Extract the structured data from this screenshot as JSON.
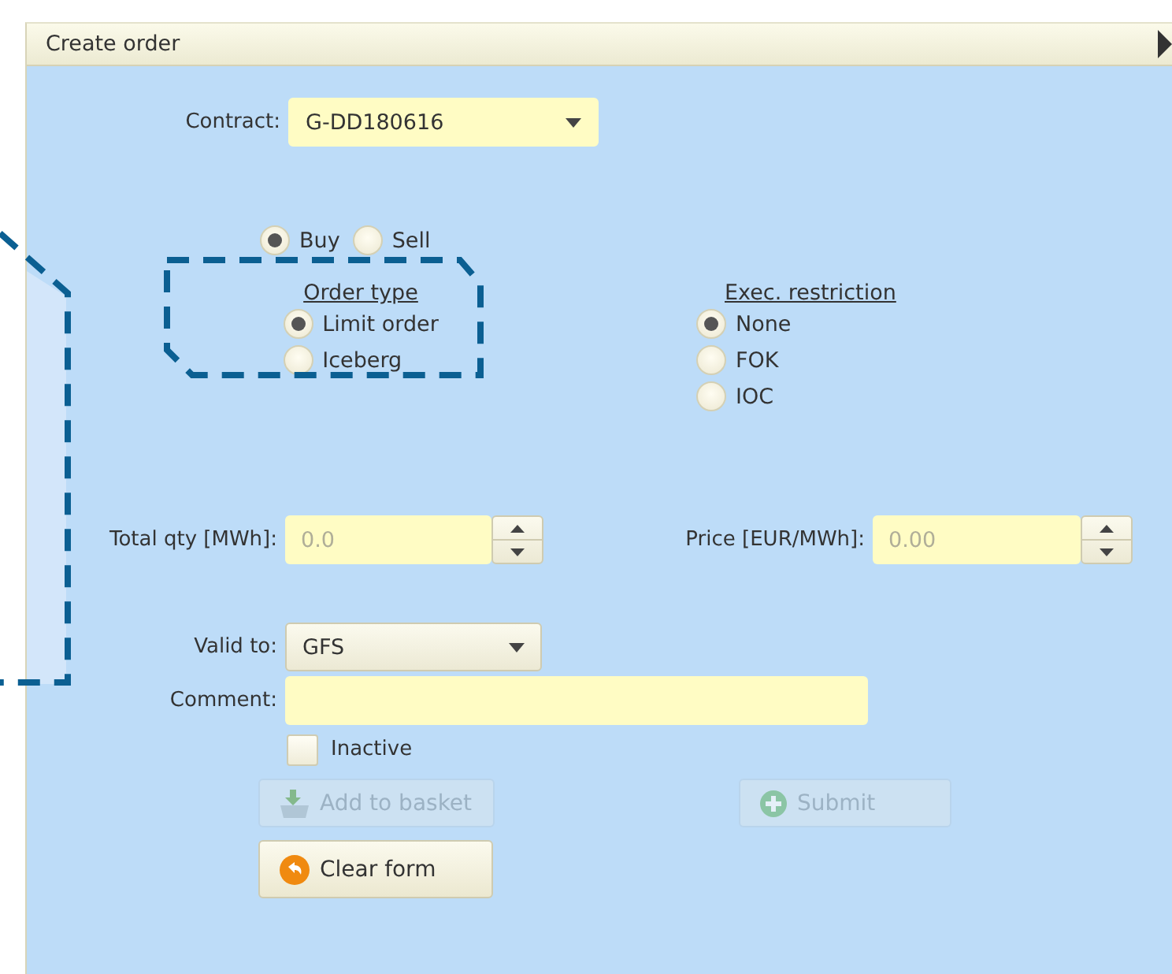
{
  "panel": {
    "title": "Create order"
  },
  "contract": {
    "label": "Contract:",
    "value": "G-DD180616"
  },
  "side": [
    {
      "label": "Buy",
      "selected": true
    },
    {
      "label": "Sell",
      "selected": false
    }
  ],
  "order_type": {
    "title": "Order type",
    "options": [
      {
        "label": "Limit order",
        "selected": true
      },
      {
        "label": "Iceberg",
        "selected": false
      }
    ]
  },
  "exec_restriction": {
    "title": "Exec. restriction",
    "options": [
      {
        "label": "None",
        "selected": true
      },
      {
        "label": "FOK",
        "selected": false
      },
      {
        "label": "IOC",
        "selected": false
      }
    ]
  },
  "total_qty": {
    "label": "Total qty [MWh]:",
    "placeholder": "0.0"
  },
  "price": {
    "label": "Price [EUR/MWh]:",
    "placeholder": "0.00"
  },
  "valid_to": {
    "label": "Valid to:",
    "value": "GFS"
  },
  "comment": {
    "label": "Comment:"
  },
  "inactive": {
    "label": "Inactive",
    "checked": false
  },
  "buttons": [
    {
      "label": "Add to basket",
      "kind": "basket",
      "disabled": true
    },
    {
      "label": "Submit",
      "kind": "submit",
      "disabled": true
    },
    {
      "label": "Clear form",
      "kind": "clear",
      "disabled": false
    }
  ]
}
